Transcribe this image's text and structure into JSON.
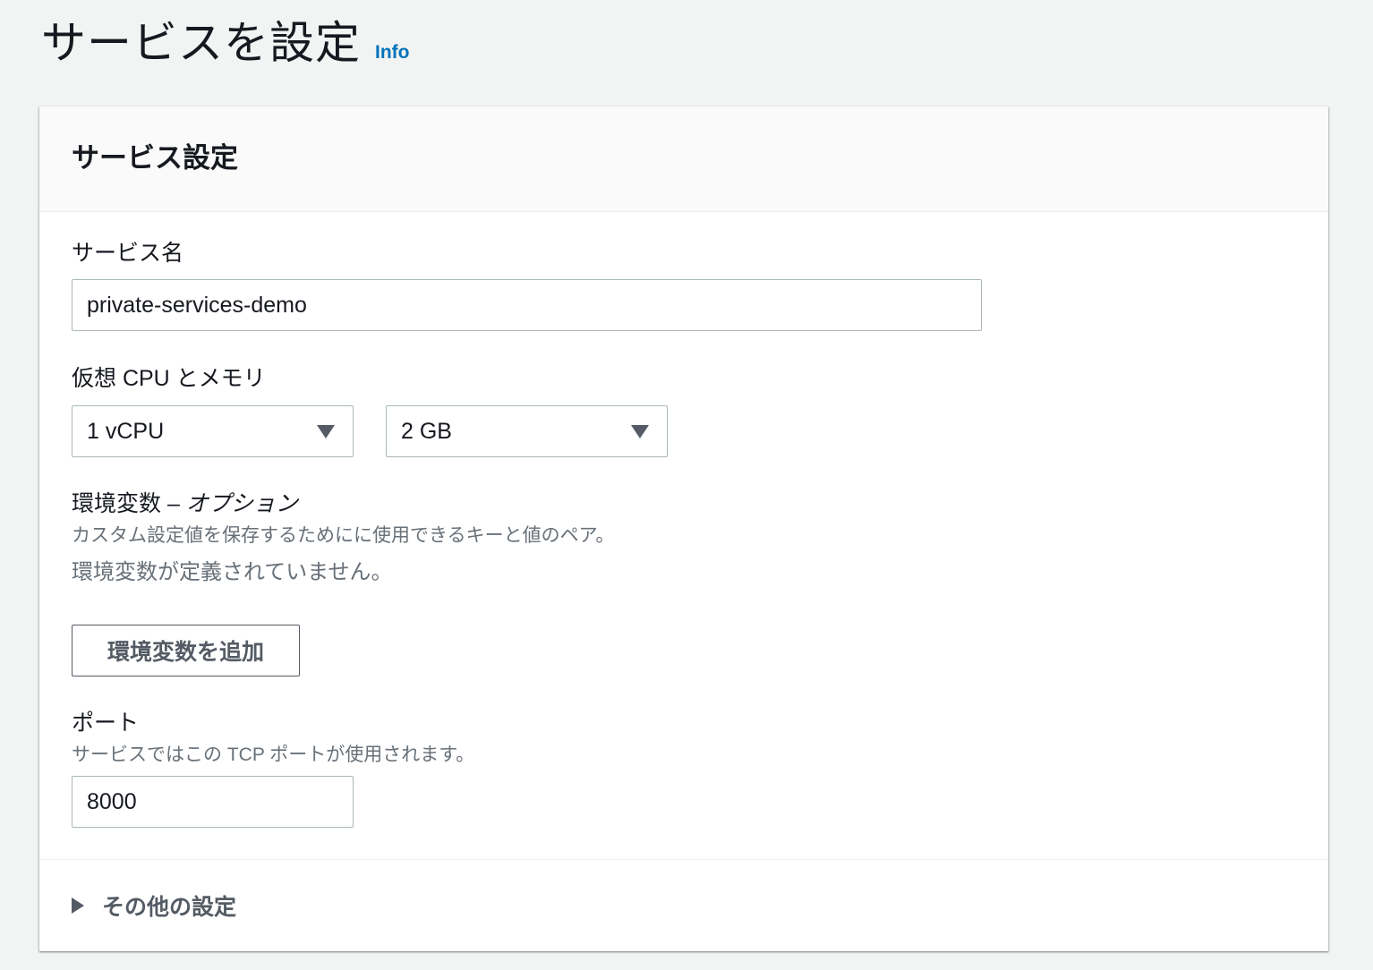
{
  "header": {
    "title": "サービスを設定",
    "info_link": "Info"
  },
  "panel": {
    "title": "サービス設定",
    "service_name": {
      "label": "サービス名",
      "value": "private-services-demo"
    },
    "cpu_memory": {
      "label": "仮想 CPU とメモリ",
      "cpu_value": "1 vCPU",
      "memory_value": "2 GB"
    },
    "env_vars": {
      "label": "環境変数",
      "label_separator": " – ",
      "label_optional": "オプション",
      "description": "カスタム設定値を保存するためにに使用できるキーと値のペア。",
      "empty_message": "環境変数が定義されていません。",
      "add_button": "環境変数を追加"
    },
    "port": {
      "label": "ポート",
      "description": "サービスではこの TCP ポートが使用されます。",
      "value": "8000"
    },
    "footer": {
      "expand_label": "その他の設定"
    }
  },
  "colors": {
    "background": "#f2f3f3",
    "link": "#0073bb",
    "text": "#16191f",
    "muted": "#687078",
    "border": "#aab7b8",
    "button_text": "#545b64"
  }
}
